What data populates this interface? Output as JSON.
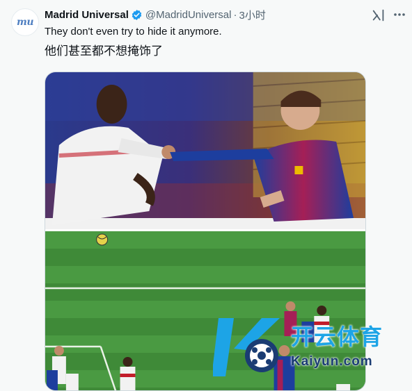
{
  "tweet": {
    "avatar_text": "mu",
    "display_name": "Madrid Universal",
    "handle": "@MadridUniversal",
    "separator": "·",
    "time": "3小时",
    "text_en": "They don't even try to hide it anymore.",
    "text_zh": "他们甚至都不想掩饰了"
  },
  "watermark": {
    "cn": "开云体育",
    "en": "Kaiyun.com"
  },
  "icons": {
    "verified": "verified-badge-icon",
    "grok": "grok-icon",
    "more": "more-options-icon"
  },
  "colors": {
    "verified": "#1d9bf0",
    "text_primary": "#0f1419",
    "text_secondary": "#536471",
    "background": "#f7f9f9",
    "watermark_cn": "#1da4e6",
    "watermark_en": "#1a3c73"
  }
}
